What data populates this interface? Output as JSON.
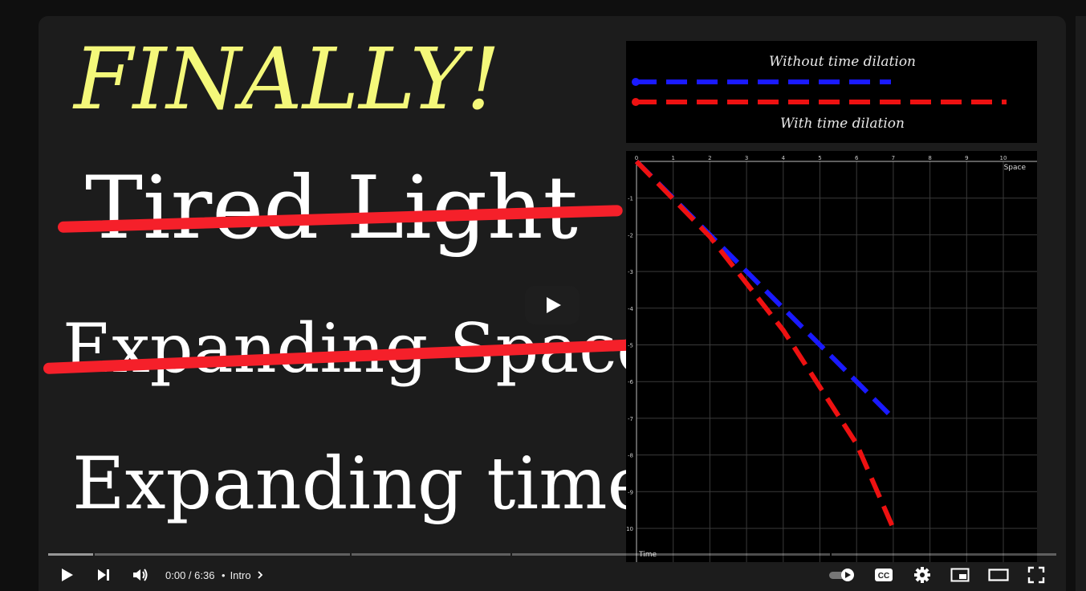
{
  "thumbnail": {
    "headline": "FINALLY!",
    "crossed_1": "Tired Light",
    "crossed_2": "Expanding Space",
    "question": "Expanding time?",
    "colors": {
      "headline": "#f4f87a",
      "strike": "#f5202a",
      "text": "#ffffff"
    }
  },
  "legend": {
    "label_top": "Without time dilation",
    "label_bottom": "With time dilation"
  },
  "chart_data": {
    "type": "line",
    "xlabel": "Space",
    "ylabel": "Time",
    "xlim": [
      0,
      11
    ],
    "ylim": [
      0,
      -11
    ],
    "x_ticks": [
      "0",
      "1",
      "2",
      "3",
      "4",
      "5",
      "6",
      "7",
      "8",
      "9",
      "10"
    ],
    "y_ticks": [
      "0",
      "-1",
      "-2",
      "-3",
      "-4",
      "-5",
      "-6",
      "-7",
      "-8",
      "-9",
      "-10"
    ],
    "grid": true,
    "series": [
      {
        "name": "Without time dilation",
        "color": "#1a1aff",
        "style": "dashed",
        "x": [
          0,
          7
        ],
        "y": [
          0,
          -7
        ]
      },
      {
        "name": "With time dilation",
        "color": "#ee1111",
        "style": "dashed",
        "x": [
          0,
          2,
          4,
          6,
          7
        ],
        "y": [
          0,
          -2.05,
          -4.6,
          -7.7,
          -10
        ]
      }
    ]
  },
  "player": {
    "time": "0:00 / 6:36",
    "chapter": "Intro",
    "chapter_sep": "•",
    "progress_played_fraction": 0.0
  }
}
